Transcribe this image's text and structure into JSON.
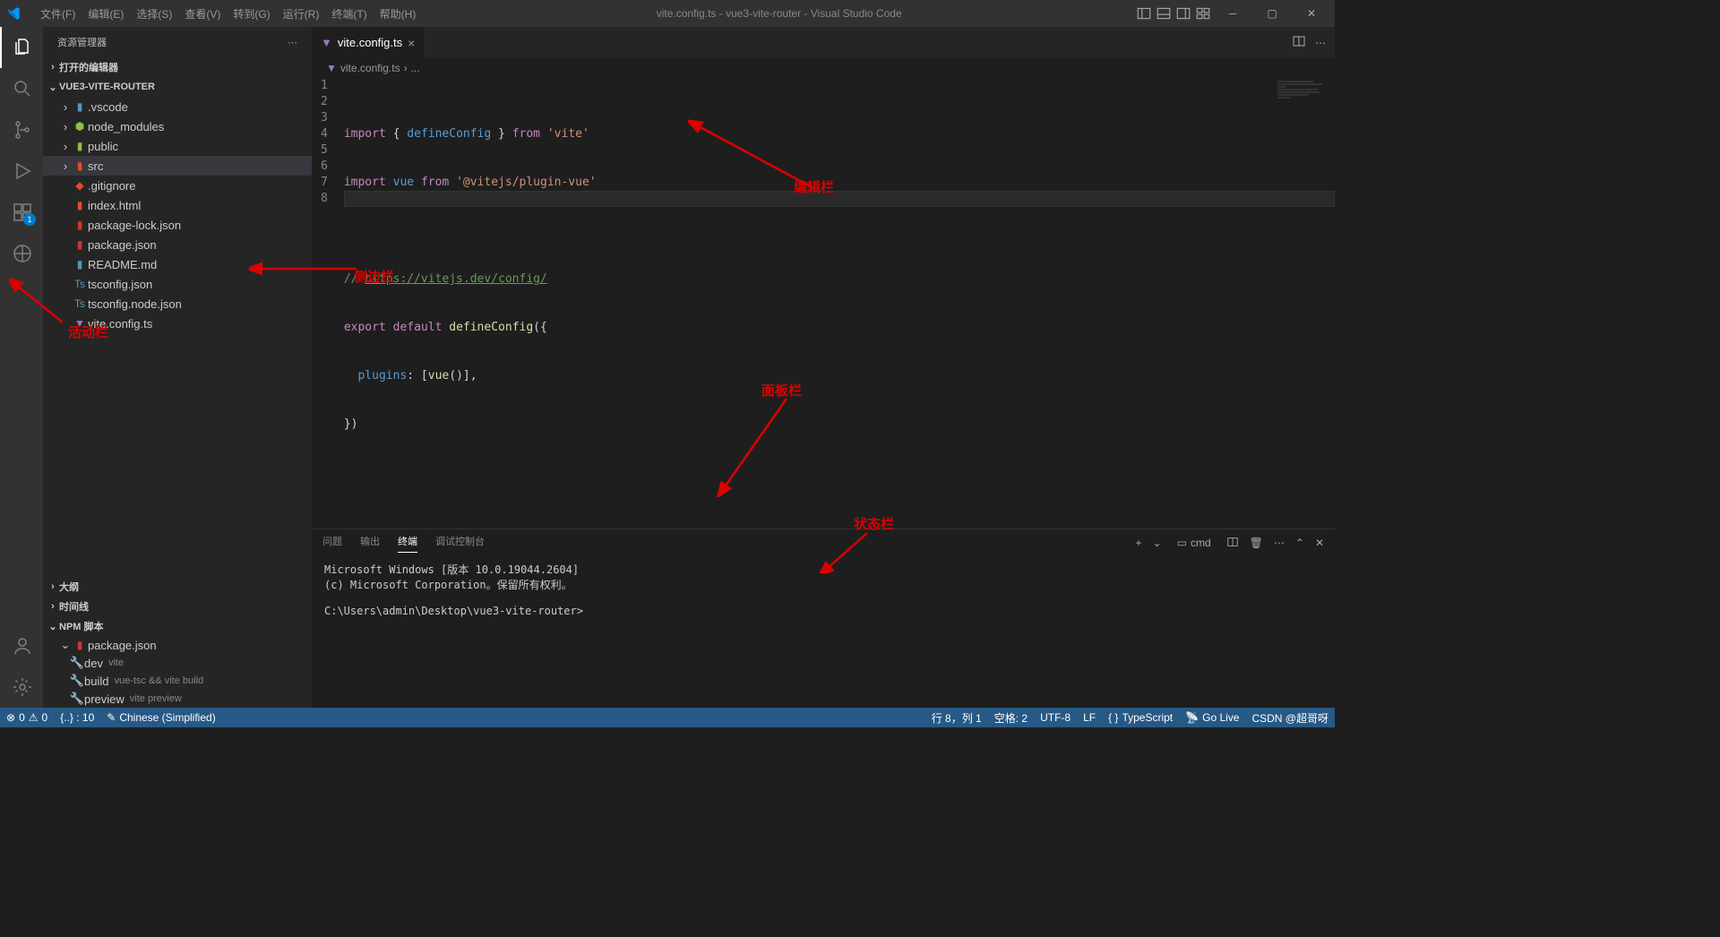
{
  "window": {
    "title": "vite.config.ts - vue3-vite-router - Visual Studio Code"
  },
  "menu": {
    "file": "文件(F)",
    "edit": "编辑(E)",
    "select": "选择(S)",
    "view": "查看(V)",
    "goto": "转到(G)",
    "run": "运行(R)",
    "terminal": "终端(T)",
    "help": "帮助(H)"
  },
  "sidebar": {
    "title": "资源管理器",
    "open_editors": "打开的编辑器",
    "project": "VUE3-VITE-ROUTER",
    "outline": "大纲",
    "timeline": "时间线",
    "npm_scripts": "NPM 脚本"
  },
  "tree": {
    "folders": {
      "vscode": ".vscode",
      "node_modules": "node_modules",
      "public": "public",
      "src": "src"
    },
    "files": {
      "gitignore": ".gitignore",
      "index_html": "index.html",
      "pkg_lock": "package-lock.json",
      "pkg": "package.json",
      "readme": "README.md",
      "tsconfig": "tsconfig.json",
      "tsconfig_node": "tsconfig.node.json",
      "vite_config": "vite.config.ts"
    }
  },
  "npm": {
    "pkg": "package.json",
    "dev": "dev",
    "dev_cmd": "vite",
    "build": "build",
    "build_cmd": "vue-tsc && vite build",
    "preview": "preview",
    "preview_cmd": "vite preview"
  },
  "tabs": {
    "active": "vite.config.ts"
  },
  "breadcrumb": {
    "file": "vite.config.ts",
    "sep": "›",
    "more": "..."
  },
  "code": {
    "l1": {
      "a": "import",
      "b": " { ",
      "c": "defineConfig",
      "d": " } ",
      "e": "from",
      "f": " ",
      "g": "'vite'"
    },
    "l2": {
      "a": "import",
      "b": " ",
      "c": "vue",
      "d": " ",
      "e": "from",
      "f": " ",
      "g": "'@vitejs/plugin-vue'"
    },
    "l4": {
      "a": "// ",
      "b": "https://vitejs.dev/config/"
    },
    "l5": {
      "a": "export",
      "b": " ",
      "c": "default",
      "d": " ",
      "e": "defineConfig",
      "f": "({"
    },
    "l6": {
      "a": "  ",
      "b": "plugins",
      "c": ": [",
      "d": "vue",
      "e": "()],"
    },
    "l7": {
      "a": "})"
    }
  },
  "panel": {
    "problems": "问题",
    "output": "输出",
    "terminal": "终端",
    "debug": "调试控制台",
    "shell": "cmd",
    "term1": "Microsoft Windows [版本 10.0.19044.2604]",
    "term2": "(c) Microsoft Corporation。保留所有权利。",
    "prompt": "C:\\Users\\admin\\Desktop\\vue3-vite-router>"
  },
  "status": {
    "errors": "0",
    "warnings": "0",
    "bracket": "{..} : 10",
    "lang_mode": "Chinese (Simplified)",
    "ln_col": "行 8，列 1",
    "spaces": "空格: 2",
    "encoding": "UTF-8",
    "eol": "LF",
    "lang": "TypeScript",
    "golive": "Go Live",
    "watermark": "CSDN @超哥呀"
  },
  "annotations": {
    "activity": "活动栏",
    "sidebar": "侧边栏",
    "editor": "编辑栏",
    "panel": "面板栏",
    "status": "状态栏"
  }
}
